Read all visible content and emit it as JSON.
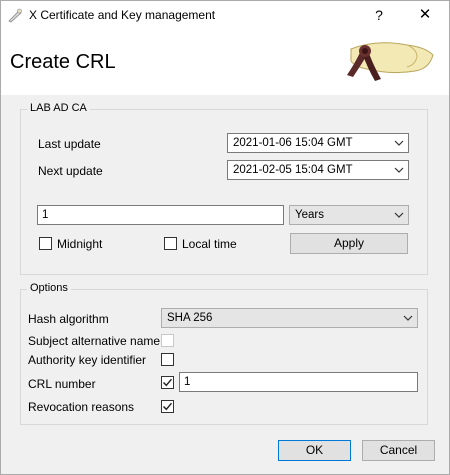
{
  "window": {
    "title": "X Certificate and Key management",
    "help_label": "?",
    "close_label": "✕"
  },
  "header": {
    "title": "Create CRL"
  },
  "ca_group": {
    "legend": "LAB AD CA",
    "last_update_label": "Last update",
    "last_update_value": "2021-01-06 15:04 GMT",
    "next_update_label": "Next update",
    "next_update_value": "2021-02-05 15:04 GMT",
    "interval_value": "1",
    "interval_unit": "Years",
    "midnight_label": "Midnight",
    "midnight_checked": false,
    "local_time_label": "Local time",
    "local_time_checked": false,
    "apply_label": "Apply"
  },
  "options_group": {
    "legend": "Options",
    "hash_label": "Hash algorithm",
    "hash_value": "SHA 256",
    "san_label": "Subject alternative name",
    "san_checked": false,
    "aki_label": "Authority key identifier",
    "aki_checked": false,
    "crl_number_label": "CRL number",
    "crl_number_checked": true,
    "crl_number_value": "1",
    "revocation_label": "Revocation reasons",
    "revocation_checked": true
  },
  "footer": {
    "ok_label": "OK",
    "cancel_label": "Cancel"
  }
}
